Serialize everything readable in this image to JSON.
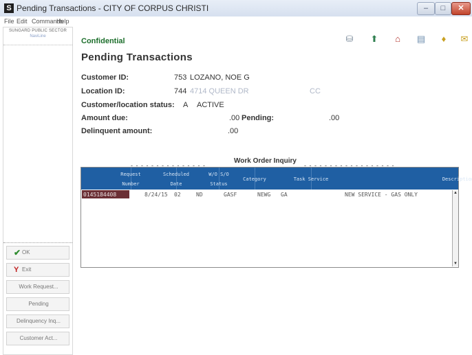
{
  "window": {
    "app_icon": "S",
    "title": "Pending Transactions - CITY OF CORPUS CHRISTI"
  },
  "menu": [
    "File",
    "Edit",
    "Commands",
    "Help"
  ],
  "left_pane": {
    "brand_line1": "SUNGARD PUBLIC SECTOR",
    "brand_line2": "NaviLine",
    "buttons": [
      {
        "label": "OK",
        "icon": "check-icon"
      },
      {
        "label": "Exit",
        "icon": "x-icon"
      },
      {
        "label": "Work Request..."
      },
      {
        "label": "Pending"
      },
      {
        "label": "Delinquency Inq..."
      },
      {
        "label": "Customer Act..."
      }
    ]
  },
  "main": {
    "confidential": "Confidential",
    "toolbar_icons": [
      "disk-icon",
      "arrow-up-icon",
      "home-icon",
      "print-icon",
      "lightbulb-icon",
      "envelope-icon"
    ],
    "page_title": "Pending Transactions",
    "fields": {
      "customer_id_label": "Customer ID:",
      "customer_id": "753",
      "customer_name": "LOZANO, NOE G",
      "location_id_label": "Location ID:",
      "location_id": "744",
      "location_addr": "4714 QUEEN DR",
      "location_suffix": "CC",
      "status_label": "Customer/location status:",
      "status_code": "A",
      "status_text": "ACTIVE",
      "amount_due_label": "Amount due:",
      "amount_due": ".00",
      "pending_label": "Pending:",
      "pending": ".00",
      "delinquent_label": "Delinquent amount:",
      "delinquent": ".00"
    },
    "section_title": "Work Order Inquiry",
    "grid": {
      "columns": [
        {
          "l1": "Request",
          "l2": "Number"
        },
        {
          "l1": "Scheduled",
          "l2": "Date"
        },
        {
          "l1": "W/O  S/O",
          "l2": "Status"
        },
        {
          "l0": "Category"
        },
        {
          "l0": "Task  Service"
        },
        {
          "l0": "Description"
        }
      ],
      "rows": [
        {
          "request": "0145184408",
          "date": "8/24/15",
          "wo": "02",
          "status": "ND",
          "category": "GASF",
          "task": "NEWG",
          "service": "GA",
          "description": "NEW SERVICE - GAS ONLY"
        }
      ]
    }
  },
  "colors": {
    "header": "#1f5fa3",
    "selected": "#6b2f34",
    "confidential": "#1c6e2b"
  }
}
